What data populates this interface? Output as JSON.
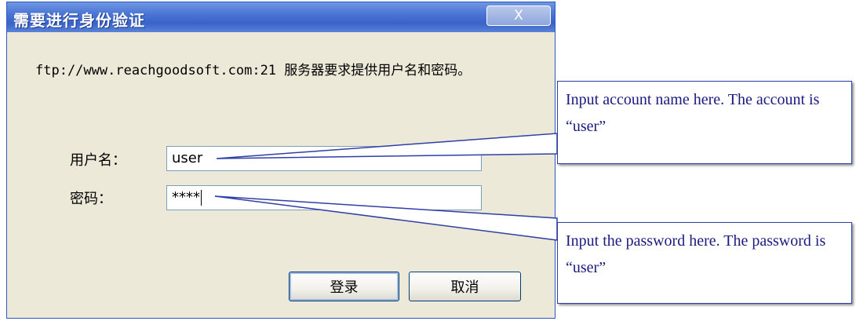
{
  "dialog": {
    "title": "需要进行身份验证",
    "close_glyph": "X",
    "prompt": "ftp://www.reachgoodsoft.com:21 服务器要求提供用户名和密码。",
    "username_label": "用户名：",
    "username_value": "user",
    "password_label": "密码：",
    "password_value": "****",
    "login_label": "登录",
    "cancel_label": "取消"
  },
  "annotations": {
    "account_note": "Input account name here. The account is “user”",
    "password_note": "Input the password here. The password is “user”"
  },
  "colors": {
    "titlebar": "#3a63c8",
    "dialog_bg": "#ece9d8",
    "callout_border": "#2f3fa5",
    "callout_text": "#1a1a80"
  },
  "icons": {
    "close": "close-icon"
  }
}
